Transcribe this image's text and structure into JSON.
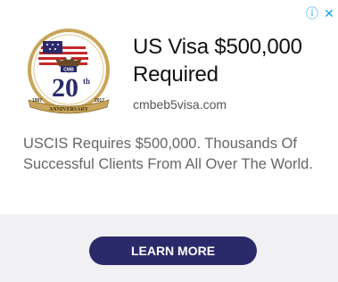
{
  "ad": {
    "headline": "US Visa $500,000 Required",
    "domain": "cmbeb5visa.com",
    "body": "USCIS Requires $500,000. Thousands Of Successful Clients From All Over The World.",
    "cta_label": "LEARN MORE"
  },
  "controls": {
    "info_glyph": "ⓘ",
    "close_glyph": "✕"
  },
  "logo": {
    "ring_text": "CMB",
    "number": "20",
    "th": "th",
    "year_left": "1997",
    "year_right": "2017",
    "banner": "ANNIVERSARY"
  },
  "colors": {
    "cta_bg": "#2a2a6b",
    "control": "#1aa3e8",
    "footer_bg": "#f1f1f4"
  }
}
